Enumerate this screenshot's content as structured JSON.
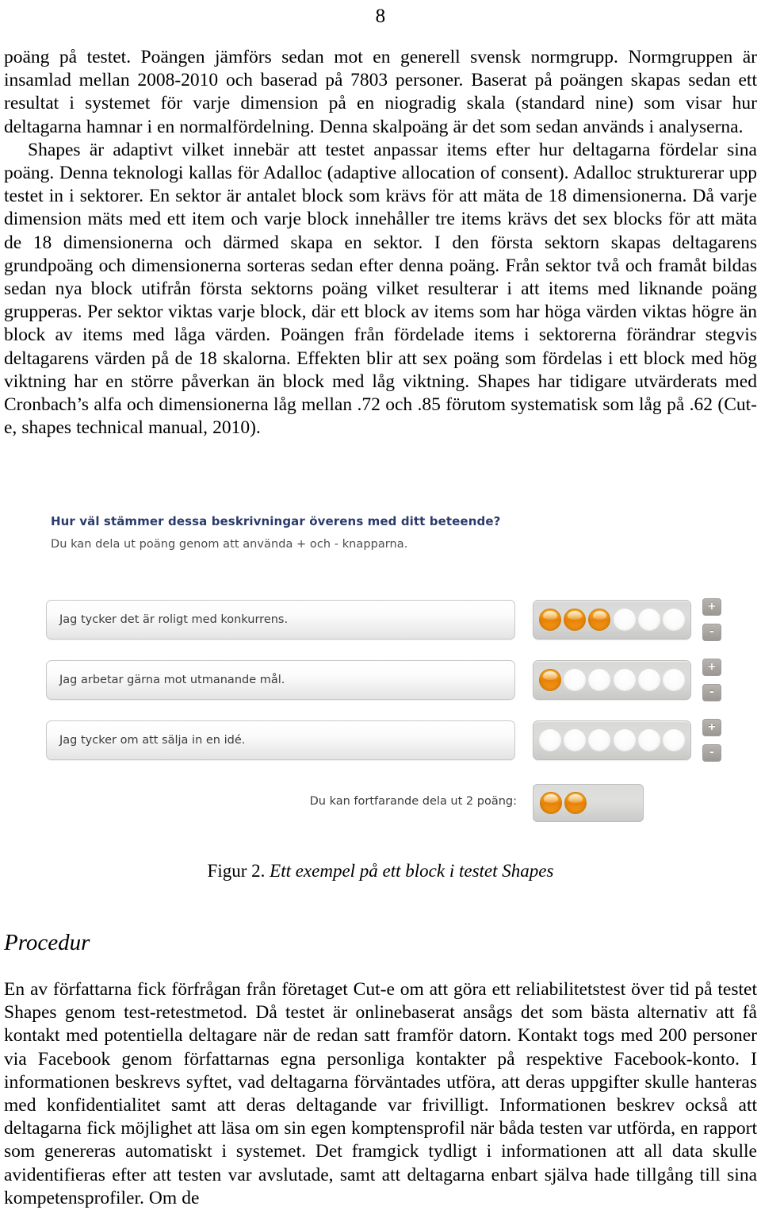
{
  "page": {
    "number": "8"
  },
  "body": {
    "paragraph_1": "poäng på testet. Poängen jämförs sedan mot en generell svensk normgrupp. Normgruppen är insamlad mellan 2008-2010 och baserad på 7803 personer. Baserat på poängen skapas sedan ett resultat i systemet för varje dimension på en niogradig skala (standard nine) som visar hur deltagarna hamnar i en normalfördelning. Denna skalpoäng är det som sedan används i analyserna.",
    "paragraph_2": "Shapes är adaptivt vilket innebär att testet anpassar items efter hur deltagarna fördelar sina poäng. Denna teknologi kallas för Adalloc (adaptive allocation of consent). Adalloc strukturerar upp testet in i sektorer. En sektor är antalet block som krävs för att mäta de 18 dimensionerna. Då varje dimension mäts med ett item och varje block innehåller tre items krävs det sex blocks för att mäta de 18 dimensionerna och därmed skapa en sektor. I den första sektorn skapas deltagarens grundpoäng och dimensionerna sorteras sedan efter denna poäng. Från sektor två och framåt bildas sedan nya block utifrån första sektorns poäng vilket resulterar i att items med liknande poäng grupperas. Per sektor viktas varje block, där ett block av items som har höga värden viktas högre än block av items med låga värden. Poängen från fördelade items i sektorerna förändrar stegvis deltagarens värden på de 18 skalorna. Effekten blir att sex poäng som fördelas i ett block med hög viktning har en större påverkan än block med låg viktning. Shapes har tidigare utvärderats med Cronbach’s alfa och dimensionerna låg mellan .72 och .85 förutom systematisk som låg på .62 (Cut-e, shapes technical manual, 2010).",
    "paragraph_3": "En av författarna fick förfrågan från företaget Cut-e om att göra ett reliabilitetstest över tid på testet Shapes genom test-retestmetod. Då testet är onlinebaserat ansågs det som bästa alternativ att få kontakt med potentiella deltagare när de redan satt framför datorn. Kontakt togs med 200 personer via Facebook genom författarnas egna personliga kontakter på respektive Facebook-konto. I informationen beskrevs syftet, vad deltagarna förväntades utföra, att deras uppgifter skulle hanteras med konfidentialitet samt att deras deltagande var frivilligt. Informationen beskrev också att deltagarna fick möjlighet att läsa om sin egen komptensprofil när båda testen var utförda, en rapport som genereras automatiskt i systemet. Det framgick tydligt i informationen att all data skulle avidentifieras efter att testen var avslutade, samt att deltagarna enbart själva hade tillgång till sina kompetensprofiler. Om de"
  },
  "section": {
    "heading": "Procedur"
  },
  "figure": {
    "caption_label": "Figur 2.",
    "caption_text": " Ett exempel på ett block i testet Shapes",
    "heading": "Hur väl stämmer dessa beskrivningar överens med ditt beteende?",
    "subheading": "Du kan dela ut poäng genom att använda + och - knapparna.",
    "heading_color": "#2a3a6b",
    "token_filled_color": "#ef8f0f",
    "token_empty_color": "#fafafa",
    "tray_color": "#d6d6d4",
    "plus_label": "+",
    "minus_label": "-",
    "total_slots": 6,
    "items": [
      {
        "label": "Jag tycker det är roligt med konkurrens.",
        "filled": 3
      },
      {
        "label": "Jag arbetar gärna mot utmanande mål.",
        "filled": 1
      },
      {
        "label": "Jag tycker om att sälja in en idé.",
        "filled": 0
      }
    ],
    "remaining": {
      "label": "Du kan fortfarande dela ut 2 poäng:",
      "count": 2
    }
  }
}
